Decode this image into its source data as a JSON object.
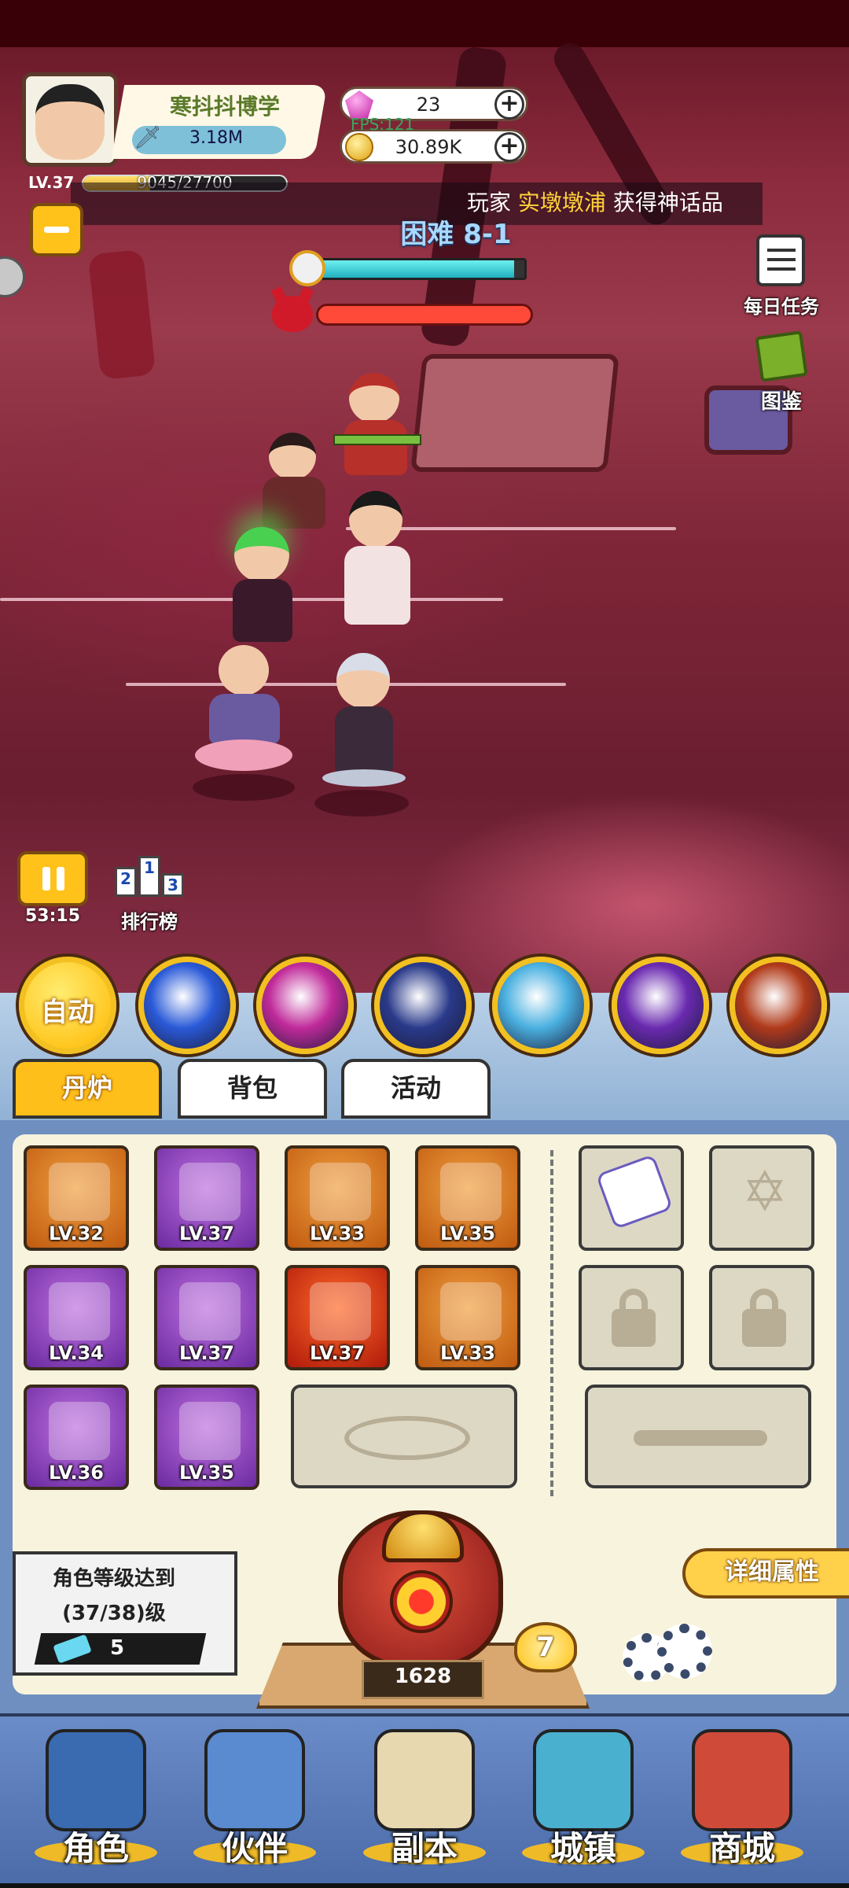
{
  "player": {
    "name": "寒抖抖博学",
    "power": "3.18M",
    "level_label": "LV.37",
    "xp_text": "9045/27700",
    "xp_fraction": 0.33
  },
  "resources": {
    "gems": "23",
    "coins": "30.89K",
    "fps_label": "FPS:121"
  },
  "ticker": {
    "prefix": "玩家",
    "player_name": "实墩墩浦",
    "suffix": "获得神话品"
  },
  "stage": {
    "title": "困难 8-1",
    "timer_fraction": 0.95,
    "boss_hp_fraction": 1.0
  },
  "side_buttons": {
    "daily_tasks": "每日任务",
    "codex": "图鉴"
  },
  "battle_controls": {
    "pause_time": "53:15",
    "ranking": "排行榜"
  },
  "skills": {
    "auto_label": "自动",
    "icons": [
      "comet-skill-icon",
      "pink-vortex-skill-icon",
      "lightning-card-skill-icon",
      "ice-wolf-skill-icon",
      "purple-spinner-skill-icon",
      "lion-beast-skill-icon"
    ],
    "colors": [
      "#2a5ad8",
      "#c02a9a",
      "#2a3a8a",
      "#4ab0e0",
      "#6a2ab0",
      "#b03a1a"
    ]
  },
  "tabs": [
    "丹炉",
    "背包",
    "活动"
  ],
  "equipment": [
    {
      "name": "spear",
      "level": "LV.32",
      "rarity": "orange"
    },
    {
      "name": "boots",
      "level": "LV.37",
      "rarity": "purple"
    },
    {
      "name": "armor",
      "level": "LV.33",
      "rarity": "orange"
    },
    {
      "name": "orb",
      "level": "LV.35",
      "rarity": "orange"
    },
    {
      "name": "dagger",
      "level": "LV.34",
      "rarity": "purple"
    },
    {
      "name": "shield",
      "level": "LV.37",
      "rarity": "purple"
    },
    {
      "name": "necklace",
      "level": "LV.37",
      "rarity": "red"
    },
    {
      "name": "ring",
      "level": "LV.33",
      "rarity": "orange"
    },
    {
      "name": "bracer",
      "level": "LV.36",
      "rarity": "purple"
    },
    {
      "name": "greaves",
      "level": "LV.35",
      "rarity": "purple"
    }
  ],
  "notice": {
    "line1": "角色等级达到",
    "line2": "(37/38)级",
    "count": "5"
  },
  "detail_button": "详细属性",
  "furnace": {
    "value": "1628",
    "level": "7"
  },
  "nav": [
    "角色",
    "伙伴",
    "副本",
    "城镇",
    "商城"
  ]
}
